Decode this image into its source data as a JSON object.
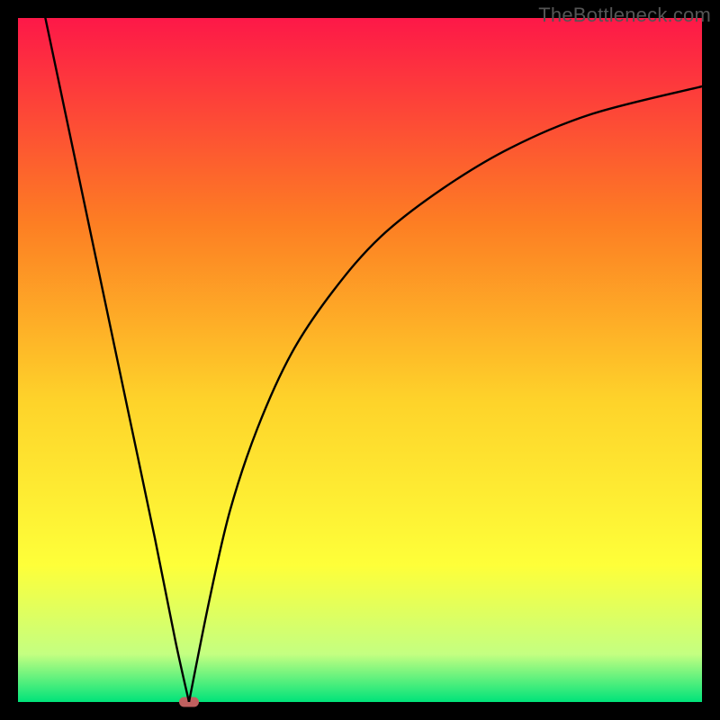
{
  "watermark": "TheBottleneck.com",
  "colors": {
    "frame": "#000000",
    "bg_top": "#fd1848",
    "bg_mid1": "#fd7e23",
    "bg_mid2": "#fed32a",
    "bg_mid3": "#feff39",
    "bg_mid4": "#c4ff81",
    "bg_bottom": "#00e37a",
    "curve": "#000000",
    "marker": "#c0605f"
  },
  "chart_data": {
    "type": "line",
    "title": "",
    "xlabel": "",
    "ylabel": "",
    "xlim": [
      0,
      100
    ],
    "ylim": [
      0,
      100
    ],
    "grid": false,
    "legend": false,
    "notes": "V-shaped bottleneck curve over red-to-green vertical gradient. Minimum at x≈25, y≈0. Left branch near-linear rising toward top-left. Right branch asymptotic toward y≈90 at right edge.",
    "gradient_stops": [
      {
        "offset": 0.0,
        "color": "#fd1848"
      },
      {
        "offset": 0.3,
        "color": "#fd7e23"
      },
      {
        "offset": 0.56,
        "color": "#fed32a"
      },
      {
        "offset": 0.8,
        "color": "#feff39"
      },
      {
        "offset": 0.93,
        "color": "#c4ff81"
      },
      {
        "offset": 1.0,
        "color": "#00e37a"
      }
    ],
    "series": [
      {
        "name": "left-branch",
        "x": [
          4,
          8,
          12,
          16,
          20,
          23,
          25
        ],
        "y": [
          100,
          81,
          62,
          43,
          24,
          9,
          0
        ]
      },
      {
        "name": "right-branch",
        "x": [
          25,
          28,
          31,
          35,
          40,
          46,
          53,
          62,
          72,
          84,
          100
        ],
        "y": [
          0,
          15,
          28,
          40,
          51,
          60,
          68,
          75,
          81,
          86,
          90
        ]
      }
    ],
    "marker": {
      "x": 25,
      "y": 0
    }
  }
}
